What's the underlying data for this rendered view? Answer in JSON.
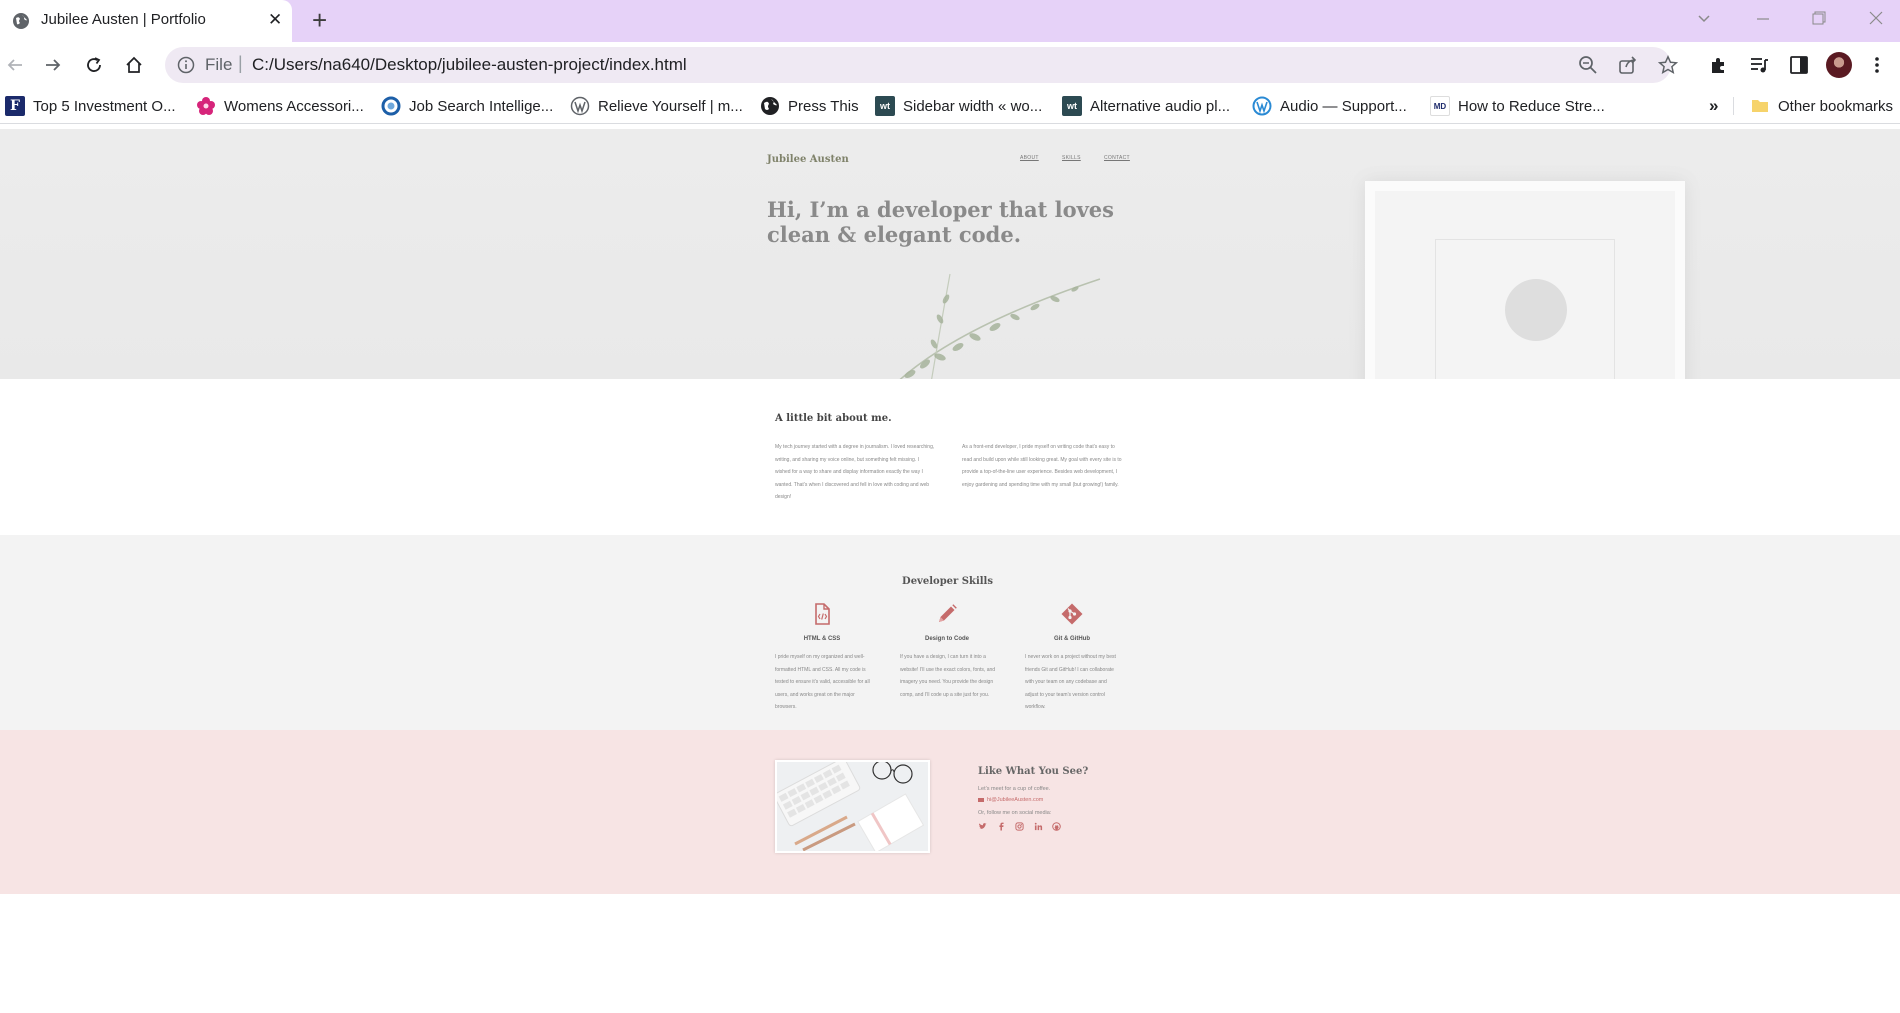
{
  "browser": {
    "tab_title": "Jubilee Austen | Portfolio",
    "tab_close": "✕",
    "new_tab": "+",
    "url_scheme": "File",
    "url": "C:/Users/na640/Desktop/jubilee-austen-project/index.html",
    "bookmarks": [
      {
        "label": "Top 5 Investment O...",
        "icon": "forbes-f-icon"
      },
      {
        "label": "Womens Accessori...",
        "icon": "flower-icon"
      },
      {
        "label": "Job Search Intellige...",
        "icon": "job-search-icon"
      },
      {
        "label": "Relieve Yourself | m...",
        "icon": "wordpress-icon"
      },
      {
        "label": "Press This",
        "icon": "globe-icon"
      },
      {
        "label": "Sidebar width « wo...",
        "icon": "wt-icon"
      },
      {
        "label": "Alternative audio pl...",
        "icon": "wt-icon"
      },
      {
        "label": "Audio — Support...",
        "icon": "wordpress-icon"
      },
      {
        "label": "How to Reduce Stre...",
        "icon": "webmd-icon"
      }
    ],
    "overflow": "»",
    "other_bookmarks": "Other bookmarks"
  },
  "site": {
    "name": "Jubilee Austen",
    "nav": [
      "ABOUT",
      "SKILLS",
      "CONTACT"
    ],
    "hero_title": "Hi, I’m a developer that loves clean & elegant code.",
    "about": {
      "title": "A little bit about me.",
      "col1": "My tech journey started with a degree in journalism. I loved researching, writing, and sharing my voice online, but something felt missing. I wished for a way to share and display information exactly the way I wanted. That’s when I discovered and fell in love with coding and web design!",
      "col2": "As a front-end developer, I pride myself on writing code that’s easy to read and build upon while still looking great. My goal with every site is to provide a top-of-the-line user experience. Besides web development, I enjoy gardening and spending time with my small (but growing!) family."
    },
    "skills": {
      "title": "Developer Skills",
      "items": [
        {
          "name": "HTML & CSS",
          "icon": "html-file-icon",
          "desc": "I pride myself on my organized and well-formatted HTML and CSS. All my code is tested to ensure it’s valid, accessible for all users, and works great on the major browsers."
        },
        {
          "name": "Design to Code",
          "icon": "pencil-icon",
          "desc": "If you have a design, I can turn it into a website! I’ll use the exact colors, fonts, and imagery you need. You provide the design comp, and I’ll code up a site just for you."
        },
        {
          "name": "Git & GitHub",
          "icon": "git-icon",
          "desc": "I never work on a project without my best friends Git and GitHub! I can collaborate with your team on any codebase and adjust to your team’s version control workflow."
        }
      ]
    },
    "contact": {
      "title": "Like What You See?",
      "line1": "Let’s meet for a cup of coffee.",
      "email": "hi@JubileeAusten.com",
      "line2": "Or, follow me on social media:",
      "social": [
        "twitter-icon",
        "facebook-icon",
        "instagram-icon",
        "linkedin-icon",
        "github-icon"
      ]
    }
  },
  "colors": {
    "accent": "#c56b6b",
    "site_name": "#7f826a",
    "contact_bg": "#f7e4e4",
    "skills_bg": "#f3f3f3",
    "tab_strip": "#e6d2f8"
  }
}
